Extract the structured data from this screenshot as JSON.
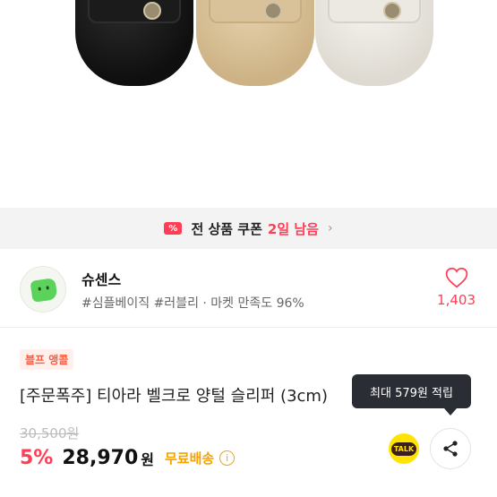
{
  "coupon": {
    "icon": "percent-coupon-icon",
    "text_prefix": "전 상품 쿠폰",
    "text_highlight": "2일 남음",
    "chevron": "›"
  },
  "seller": {
    "name": "슈센스",
    "tags": "#심플베이직 #러블리 · 마켓 만족도 96%",
    "likes": "1,403"
  },
  "product": {
    "tag": "블프 앵콜",
    "title": "[주문폭주] 티아라 벨크로 양털 슬리퍼 (3cm)",
    "tooltip": "최대 579원 적립",
    "original_price": "30,500원",
    "discount": "5%",
    "price": "28,970",
    "currency": "원",
    "shipping": "무료배송",
    "talk_label": "TALK"
  },
  "colors": {
    "accent": "#ff3d55",
    "shipping": "#f5a300",
    "kakao": "#ffe400"
  }
}
